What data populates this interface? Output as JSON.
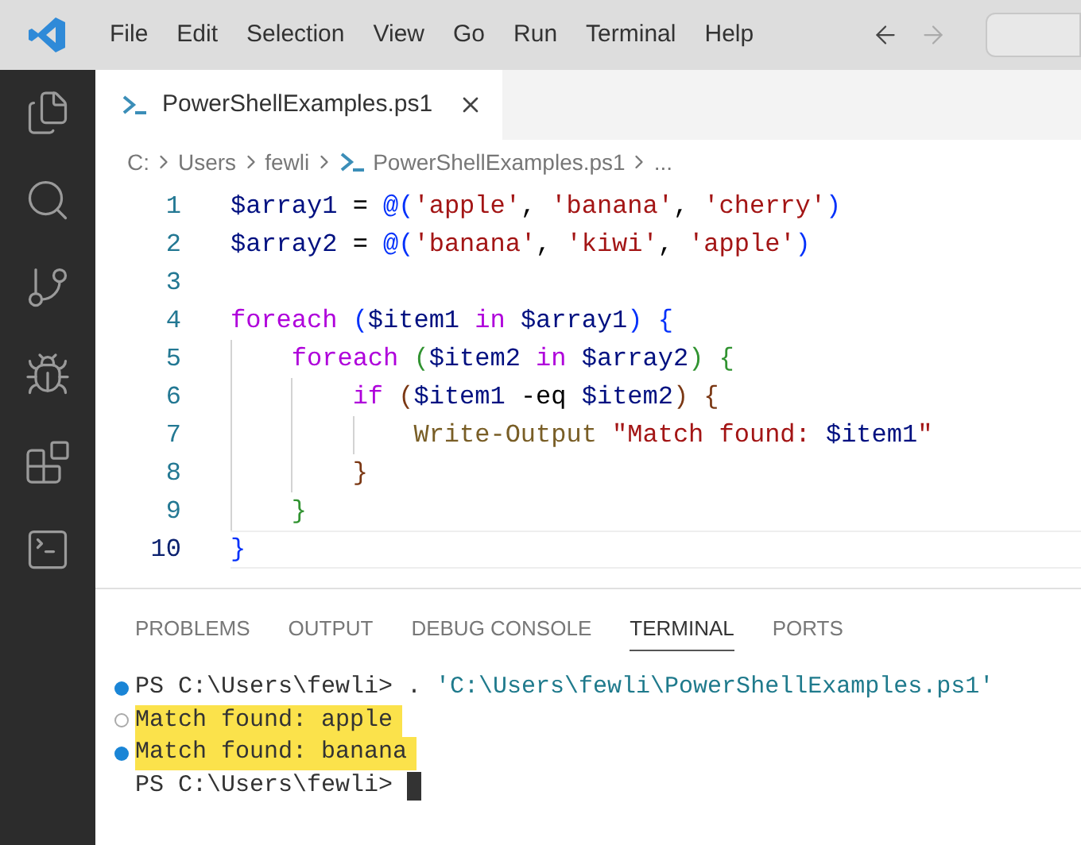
{
  "menu_bar": {
    "items": [
      "File",
      "Edit",
      "Selection",
      "View",
      "Go",
      "Run",
      "Terminal",
      "Help"
    ],
    "nav": [
      {
        "kind": "back",
        "disabled": false
      },
      {
        "kind": "forward",
        "disabled": true
      }
    ]
  },
  "activity_bar": {
    "items": [
      {
        "kind": "files",
        "selected": false
      },
      {
        "kind": "search",
        "selected": false
      },
      {
        "kind": "source-control",
        "selected": false
      },
      {
        "kind": "run-debug",
        "selected": false
      },
      {
        "kind": "extensions",
        "selected": false
      },
      {
        "kind": "terminal",
        "selected": false
      }
    ]
  },
  "tabs": [
    {
      "label": "PowerShellExamples.ps1",
      "selected": true
    }
  ],
  "breadcrumbs": [
    {
      "label": "C:",
      "kind": "folder"
    },
    {
      "label": "Users",
      "kind": "folder"
    },
    {
      "label": "fewli",
      "kind": "folder"
    },
    {
      "label": "PowerShellExamples.ps1",
      "kind": "file"
    },
    {
      "label": "...",
      "kind": "more"
    }
  ],
  "code": [
    {
      "number": "1",
      "current": false,
      "tokens": [
        {
          "t": "$array1",
          "kind": "var"
        },
        {
          "t": " = ",
          "kind": "plain"
        },
        {
          "t": "@(",
          "kind": "b1"
        },
        {
          "t": "'apple'",
          "kind": "str"
        },
        {
          "t": ", ",
          "kind": "plain"
        },
        {
          "t": "'banana'",
          "kind": "str"
        },
        {
          "t": ", ",
          "kind": "plain"
        },
        {
          "t": "'cherry'",
          "kind": "str"
        },
        {
          "t": ")",
          "kind": "b1"
        }
      ]
    },
    {
      "number": "2",
      "current": false,
      "tokens": [
        {
          "t": "$array2",
          "kind": "var"
        },
        {
          "t": " = ",
          "kind": "plain"
        },
        {
          "t": "@(",
          "kind": "b1"
        },
        {
          "t": "'banana'",
          "kind": "str"
        },
        {
          "t": ", ",
          "kind": "plain"
        },
        {
          "t": "'kiwi'",
          "kind": "str"
        },
        {
          "t": ", ",
          "kind": "plain"
        },
        {
          "t": "'apple'",
          "kind": "str"
        },
        {
          "t": ")",
          "kind": "b1"
        }
      ]
    },
    {
      "number": "3",
      "current": false
    },
    {
      "number": "4",
      "current": false,
      "tokens": [
        {
          "t": "foreach ",
          "kind": "kw"
        },
        {
          "t": "(",
          "kind": "b1"
        },
        {
          "t": "$item1",
          "kind": "var"
        },
        {
          "t": " in ",
          "kind": "kw"
        },
        {
          "t": "$array1",
          "kind": "var"
        },
        {
          "t": ")",
          "kind": "b1"
        },
        {
          "t": " {",
          "kind": "b1"
        }
      ]
    },
    {
      "number": "5",
      "current": false,
      "tokens": [
        {
          "t": "    foreach ",
          "kind": "kw"
        },
        {
          "t": "(",
          "kind": "b2"
        },
        {
          "t": "$item2",
          "kind": "var"
        },
        {
          "t": " in ",
          "kind": "kw"
        },
        {
          "t": "$array2",
          "kind": "var"
        },
        {
          "t": ")",
          "kind": "b2"
        },
        {
          "t": " {",
          "kind": "b2"
        }
      ]
    },
    {
      "number": "6",
      "current": false,
      "tokens": [
        {
          "t": "        if ",
          "kind": "kw"
        },
        {
          "t": "(",
          "kind": "b3"
        },
        {
          "t": "$item1",
          "kind": "var"
        },
        {
          "t": " -eq ",
          "kind": "plain"
        },
        {
          "t": "$item2",
          "kind": "var"
        },
        {
          "t": ")",
          "kind": "b3"
        },
        {
          "t": " {",
          "kind": "b3"
        }
      ]
    },
    {
      "number": "7",
      "current": false,
      "tokens": [
        {
          "t": "            Write-Output ",
          "kind": "cmd"
        },
        {
          "t": "\"Match found: ",
          "kind": "str"
        },
        {
          "t": "$item1",
          "kind": "var"
        },
        {
          "t": "\"",
          "kind": "str"
        }
      ]
    },
    {
      "number": "8",
      "current": false,
      "tokens": [
        {
          "t": "        }",
          "kind": "b3"
        }
      ]
    },
    {
      "number": "9",
      "current": false,
      "tokens": [
        {
          "t": "    }",
          "kind": "b2"
        }
      ]
    },
    {
      "number": "10",
      "current": true,
      "tokens": [
        {
          "t": "}",
          "kind": "b1"
        }
      ]
    }
  ],
  "panel_tabs": [
    {
      "label": "PROBLEMS",
      "selected": false
    },
    {
      "label": "OUTPUT",
      "selected": false
    },
    {
      "label": "DEBUG CONSOLE",
      "selected": false
    },
    {
      "label": "TERMINAL",
      "selected": true
    },
    {
      "label": "PORTS",
      "selected": false
    }
  ],
  "terminal": [
    {
      "kind": "success",
      "highlighted": false,
      "cursor": false,
      "parts": [
        {
          "t": "PS C:\\Users\\fewli> . ",
          "kind": "plain"
        },
        {
          "t": "'C:\\Users\\fewli\\PowerShellExamples.ps1'",
          "kind": "path"
        }
      ]
    },
    {
      "kind": "empty",
      "highlighted": true,
      "cursor": false,
      "parts": [
        {
          "t": "Match found: apple",
          "kind": "plain"
        }
      ]
    },
    {
      "kind": "success",
      "highlighted": true,
      "cursor": false,
      "parts": [
        {
          "t": "Match found: banana",
          "kind": "plain"
        }
      ]
    },
    {
      "kind": "prompt",
      "highlighted": false,
      "cursor": true,
      "parts": [
        {
          "t": "PS C:\\Users\\fewli> ",
          "kind": "plain"
        }
      ]
    }
  ]
}
